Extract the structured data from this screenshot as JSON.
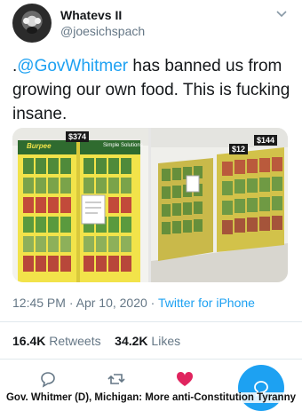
{
  "user": {
    "display_name": "Whatevs II",
    "handle": "@joesichspach"
  },
  "tweet": {
    "prefix": ".",
    "mention": "@GovWhitmer",
    "body": " has banned us from growing our own food. This is fucking insane."
  },
  "media": {
    "left_price": "$374",
    "right_price": "$144",
    "right_price_small": "$12",
    "brand": "Burpee",
    "sub_brand": "Simple Solutions"
  },
  "meta": {
    "time": "12:45 PM",
    "sep": " · ",
    "date": "Apr 10, 2020",
    "sep2": " · ",
    "source": "Twitter for iPhone"
  },
  "stats": {
    "retweets_count": "16.4K",
    "retweets_label": " Retweets",
    "likes_count": "34.2K",
    "likes_label": " Likes"
  },
  "caption": "Gov. Whitmer (D), Michigan: More anti-Constitution Tyranny",
  "icons": {
    "reply": "reply-icon",
    "retweet": "retweet-icon",
    "like": "heart-icon",
    "compose": "compose-icon",
    "more": "chevron-down-icon"
  },
  "colors": {
    "accent": "#1da1f2",
    "like": "#e0245e",
    "muted": "#657786"
  }
}
